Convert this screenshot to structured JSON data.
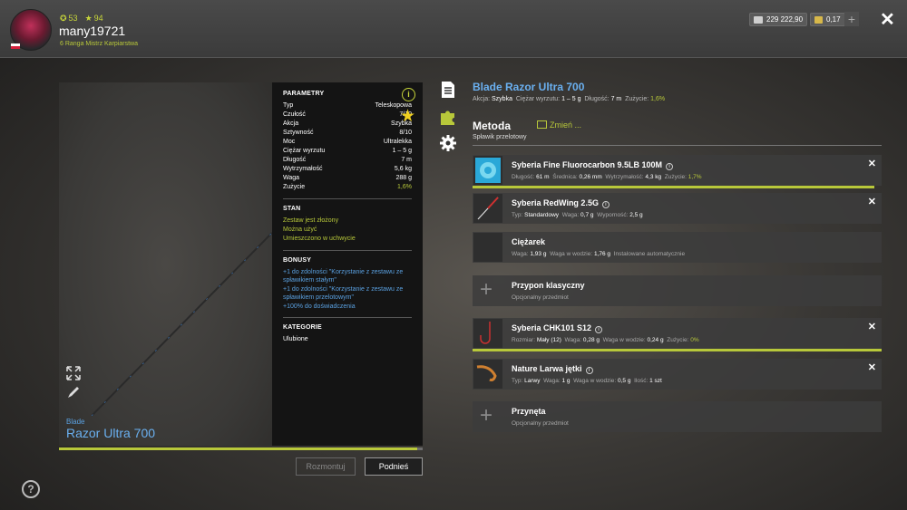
{
  "player": {
    "level": "53",
    "rank_level": "94",
    "username": "many19721",
    "rank_title": "6 Ranga Mistrz Karpiarstwa"
  },
  "currency": {
    "silver": "229 222,90",
    "gold": "0,17"
  },
  "rod": {
    "brand": "Blade",
    "name": "Razor Ultra 700",
    "full_name": "Blade Razor Ultra 700",
    "condition_percent": 98.4
  },
  "params": {
    "heading": "PARAMETRY",
    "rows": [
      {
        "label": "Typ",
        "value": "Teleskopowa"
      },
      {
        "label": "Czułość",
        "value": "7/10"
      },
      {
        "label": "Akcja",
        "value": "Szybka"
      },
      {
        "label": "Sztywność",
        "value": "8/10"
      },
      {
        "label": "Moc",
        "value": "Ultralekka"
      },
      {
        "label": "Ciężar wyrzutu",
        "value": "1 – 5 g"
      },
      {
        "label": "Długość",
        "value": "7 m"
      },
      {
        "label": "Wytrzymałość",
        "value": "5,6 kg"
      },
      {
        "label": "Waga",
        "value": "288 g"
      },
      {
        "label": "Zużycie",
        "value": "1,6%"
      }
    ],
    "state_heading": "STAN",
    "state": [
      "Zestaw jest złożony",
      "Można użyć",
      "Umieszczono w uchwycie"
    ],
    "bonus_heading": "BONUSY",
    "bonuses": [
      "+1 do zdolności \"Korzystanie z zestawu ze spławikiem stałym\"",
      "+1 do zdolności \"Korzystanie z zestawu ze spławikiem przelotowym\"",
      "+100% do doświadczenia"
    ],
    "category_heading": "KATEGORIE",
    "category": "Ulubione"
  },
  "buttons": {
    "dismantle": "Rozmontuj",
    "pickup": "Podnieś"
  },
  "summary": {
    "action_label": "Akcja:",
    "action": "Szybka",
    "cast_label": "Ciężar wyrzutu:",
    "cast": "1 – 5 g",
    "length_label": "Długość:",
    "length": "7 m",
    "wear_label": "Zużycie:",
    "wear": "1,6%"
  },
  "method": {
    "title": "Metoda",
    "subtitle": "Spławik przelotowy",
    "change": "Zmień ..."
  },
  "slots": [
    {
      "name": "Syberia Fine Fluorocarbon 9.5LB 100M",
      "details": [
        {
          "label": "Długość:",
          "value": "61 m"
        },
        {
          "label": "Średnica:",
          "value": "0,26 mm"
        },
        {
          "label": "Wytrzymałość:",
          "value": "4,3 kg"
        },
        {
          "label": "Zużycie:",
          "value": "1,7%",
          "accent": true
        }
      ],
      "removable": true,
      "bar_percent": 98.3
    },
    {
      "name": "Syberia RedWing 2.5G",
      "details": [
        {
          "label": "Typ:",
          "value": "Standardowy"
        },
        {
          "label": "Waga:",
          "value": "0,7 g"
        },
        {
          "label": "Wyporność:",
          "value": "2,5 g"
        }
      ],
      "removable": true
    },
    {
      "name": "Ciężarek",
      "details": [
        {
          "label": "Waga:",
          "value": "1,93 g"
        },
        {
          "label": "Waga w wodzie:",
          "value": "1,76 g"
        },
        {
          "label": "Instalowane automatycznie",
          "value": ""
        }
      ],
      "removable": false
    },
    {
      "name": "Przypon klasyczny",
      "plain": "Opcjonalny przedmiot",
      "empty": true
    },
    {
      "name": "Syberia CHK101 S12",
      "details": [
        {
          "label": "Rozmiar:",
          "value": "Mały (12)"
        },
        {
          "label": "Waga:",
          "value": "0,28 g"
        },
        {
          "label": "Waga w wodzie:",
          "value": "0,24 g"
        },
        {
          "label": "Zużycie:",
          "value": "0%",
          "accent": true
        }
      ],
      "removable": true,
      "bar_percent": 100
    },
    {
      "name": "Nature Larwa jętki",
      "details": [
        {
          "label": "Typ:",
          "value": "Larwy"
        },
        {
          "label": "Waga:",
          "value": "1 g"
        },
        {
          "label": "Waga w wodzie:",
          "value": "0,5 g"
        },
        {
          "label": "Ilość:",
          "value": "1 szt"
        }
      ],
      "removable": true
    },
    {
      "name": "Przynęta",
      "plain": "Opcjonalny przedmiot",
      "empty": true
    }
  ],
  "colors": {
    "accent": "#b8c83a",
    "link_blue": "#6ab0f0"
  }
}
